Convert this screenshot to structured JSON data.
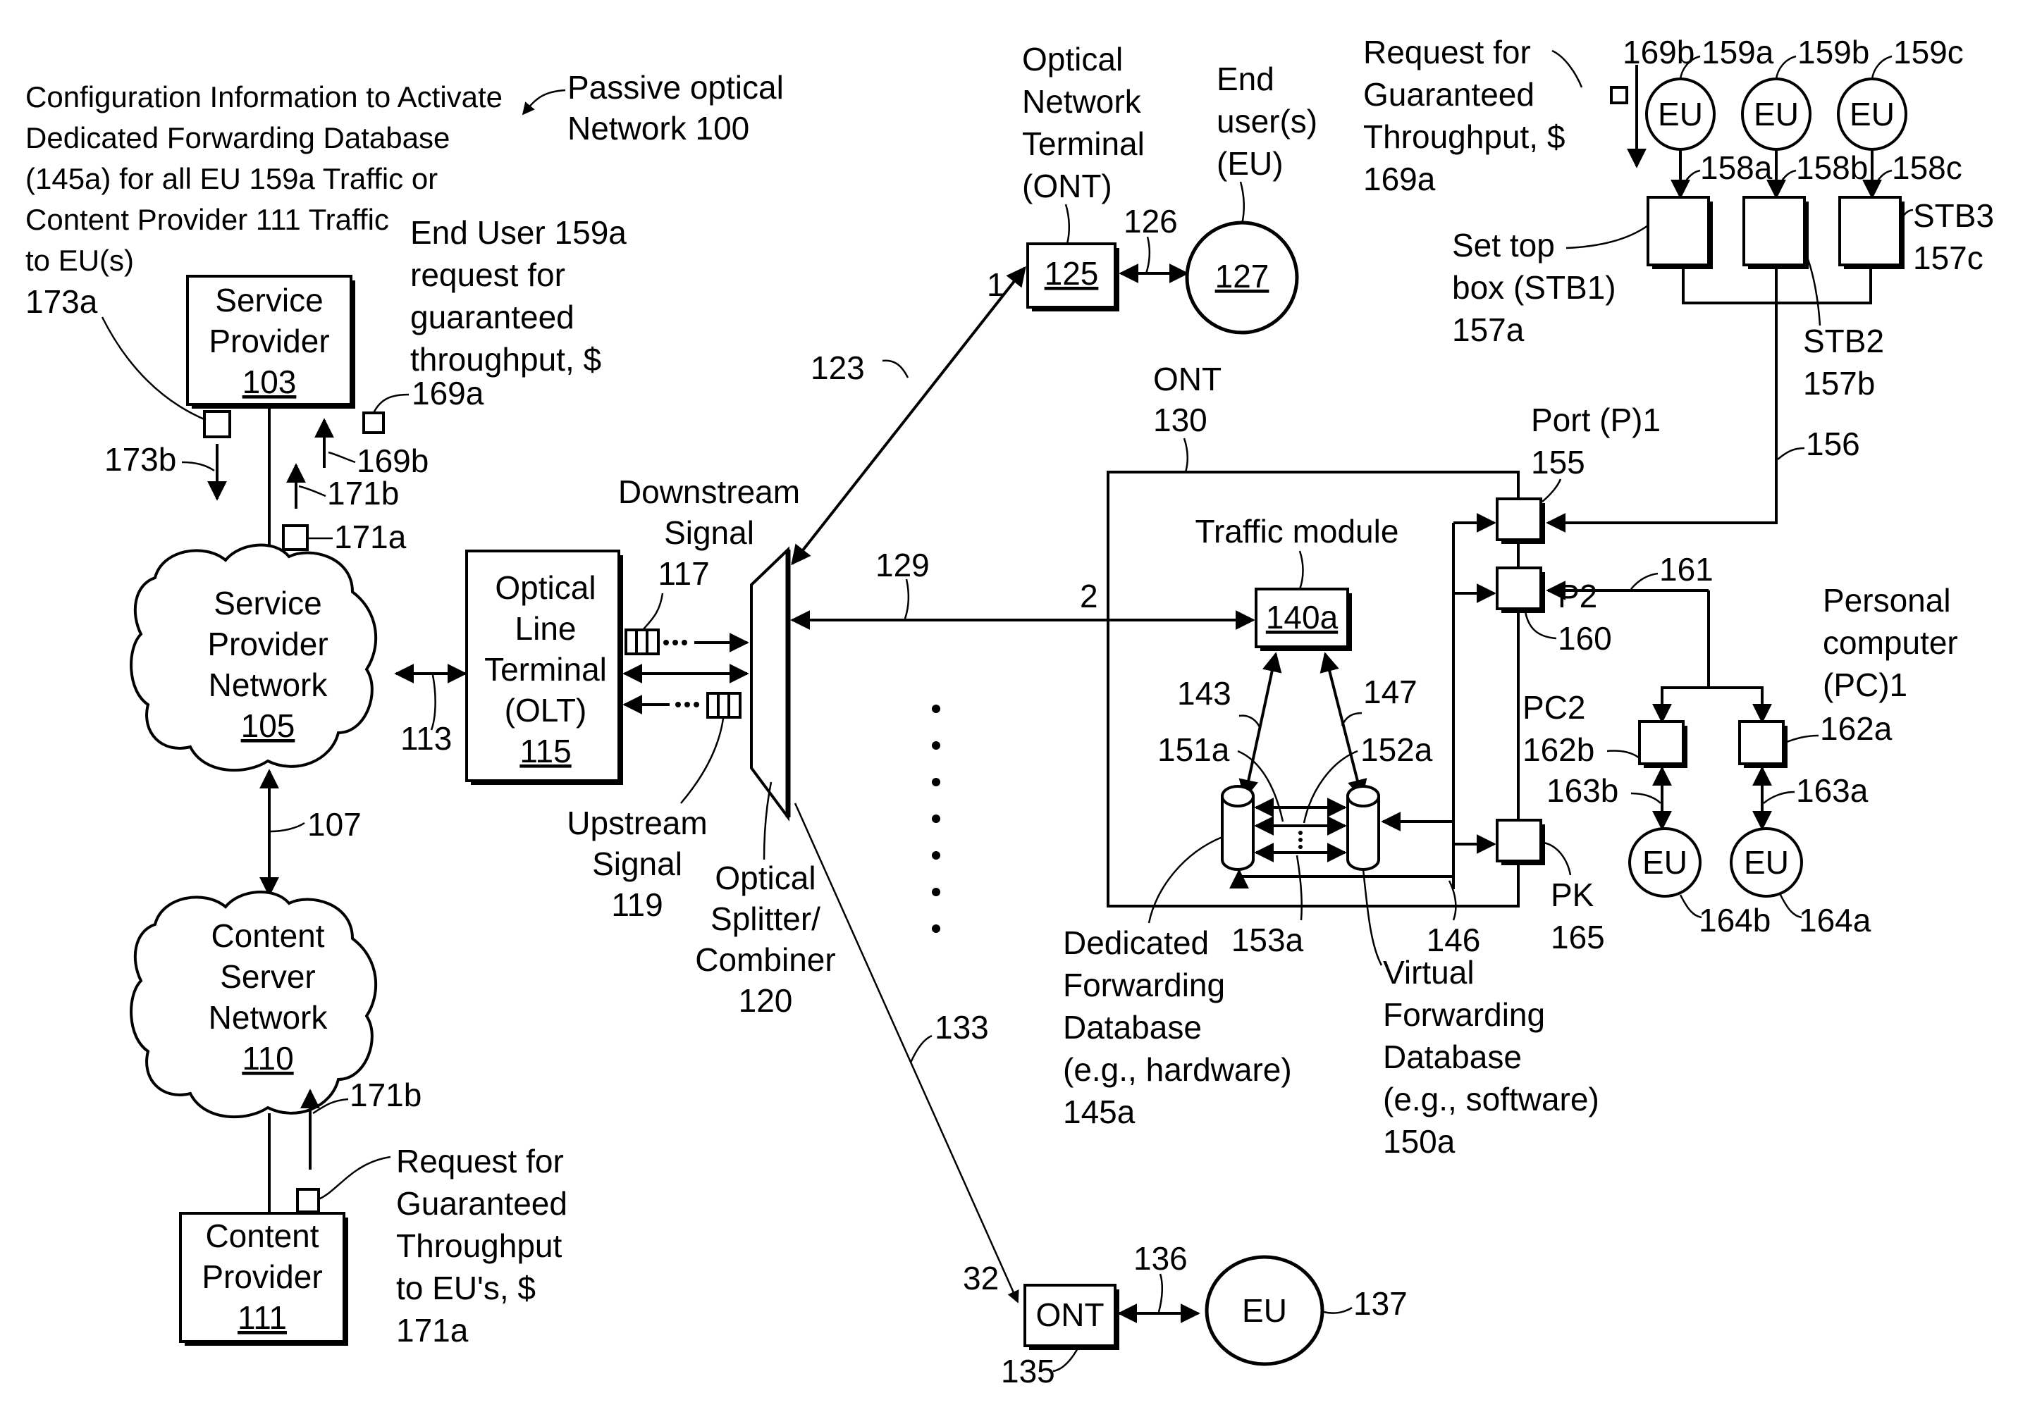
{
  "figure": {
    "title": "Passive optical Network 100",
    "title_lines": [
      "Passive optical",
      "Network 100"
    ],
    "config_note_lines": [
      "Configuration Information to Activate",
      "Dedicated Forwarding Database",
      "(145a) for all EU 159a Traffic or",
      "Content Provider 111 Traffic",
      "to EU(s)",
      "173a"
    ],
    "end_user_request_lines": [
      "End User 159a",
      "request for",
      "guaranteed",
      "throughput, $"
    ]
  },
  "nodes": {
    "service_provider": {
      "lines": [
        "Service",
        "Provider"
      ],
      "ref": "103"
    },
    "service_provider_network": {
      "lines": [
        "Service",
        "Provider",
        "Network"
      ],
      "ref": "105"
    },
    "content_server_network": {
      "lines": [
        "Content",
        "Server",
        "Network"
      ],
      "ref": "110"
    },
    "content_provider": {
      "lines": [
        "Content",
        "Provider"
      ],
      "ref": "111"
    },
    "olt": {
      "lines": [
        "Optical",
        "Line",
        "Terminal",
        "(OLT)"
      ],
      "ref": "115"
    },
    "splitter": {
      "lines": [
        "Optical",
        "Splitter/",
        "Combiner",
        "120"
      ]
    },
    "ont_125": {
      "ref": "125",
      "caption_lines": [
        "Optical",
        "Network",
        "Terminal",
        "(ONT)"
      ]
    },
    "eu_127": {
      "ref": "127",
      "caption_lines": [
        "End",
        "user(s)",
        "(EU)"
      ]
    },
    "ont_130": {
      "caption_lines": [
        "ONT",
        "130"
      ]
    },
    "traffic_module": {
      "caption": "Traffic module",
      "ref": "140a"
    },
    "dedicated_fdb": {
      "lines": [
        "Dedicated",
        "Forwarding",
        "Database",
        "(e.g., hardware)",
        "145a"
      ]
    },
    "virtual_fdb": {
      "lines": [
        "Virtual",
        "Forwarding",
        "Database",
        "(e.g., software)",
        "150a"
      ]
    },
    "ont_135": {
      "label": "ONT",
      "ref": "135"
    },
    "eu_137": {
      "label": "EU",
      "ref": "137"
    },
    "ports": {
      "p1": {
        "lines": [
          "Port (P)1",
          "155"
        ]
      },
      "p2": {
        "lines": [
          "P2",
          "160"
        ]
      },
      "pk": {
        "lines": [
          "PK",
          "165"
        ]
      }
    },
    "stb1": {
      "lines": [
        "Set top",
        "box (STB1)",
        "157a"
      ]
    },
    "stb2": {
      "lines": [
        "STB2",
        "157b"
      ]
    },
    "stb3": {
      "lines": [
        "STB3",
        "157c"
      ]
    },
    "pc1": {
      "lines": [
        "Personal",
        "computer",
        "(PC)1"
      ],
      "ref": "162a"
    },
    "pc2": {
      "lines": [
        "PC2"
      ],
      "ref": "162b"
    },
    "eu_159a": {
      "label": "EU",
      "ref": "159a"
    },
    "eu_159b": {
      "label": "EU",
      "ref": "159b"
    },
    "eu_159c": {
      "label": "EU",
      "ref": "159c"
    },
    "eu_164a": {
      "label": "EU",
      "ref": "164a"
    },
    "eu_164b": {
      "label": "EU",
      "ref": "164b"
    }
  },
  "signals": {
    "downstream": {
      "lines": [
        "Downstream",
        "Signal",
        "117"
      ]
    },
    "upstream": {
      "lines": [
        "Upstream",
        "Signal",
        "119"
      ]
    },
    "request_eu_lines": [
      "Request for",
      "Guaranteed",
      "Throughput, $",
      "169a"
    ],
    "request_cp_lines": [
      "Request for",
      "Guaranteed",
      "Throughput",
      "to EU's, $",
      "171a"
    ]
  },
  "refs": {
    "r107": "107",
    "r113": "113",
    "r123": "123",
    "r126": "126",
    "r129": "129",
    "r133": "133",
    "r136": "136",
    "r143": "143",
    "r146": "146",
    "r147": "147",
    "r151a": "151a",
    "r152a": "152a",
    "r153a": "153a",
    "r156": "156",
    "r161": "161",
    "r158a": "158a",
    "r158b": "158b",
    "r158c": "158c",
    "r163a": "163a",
    "r163b": "163b",
    "r169a": "169a",
    "r169b": "169b",
    "r169b_top": "169b",
    "r171a": "171a",
    "r171b": "171b",
    "r171b_bottom": "171b",
    "r173b": "173b",
    "port1": "1",
    "port2": "2",
    "port32": "32"
  }
}
